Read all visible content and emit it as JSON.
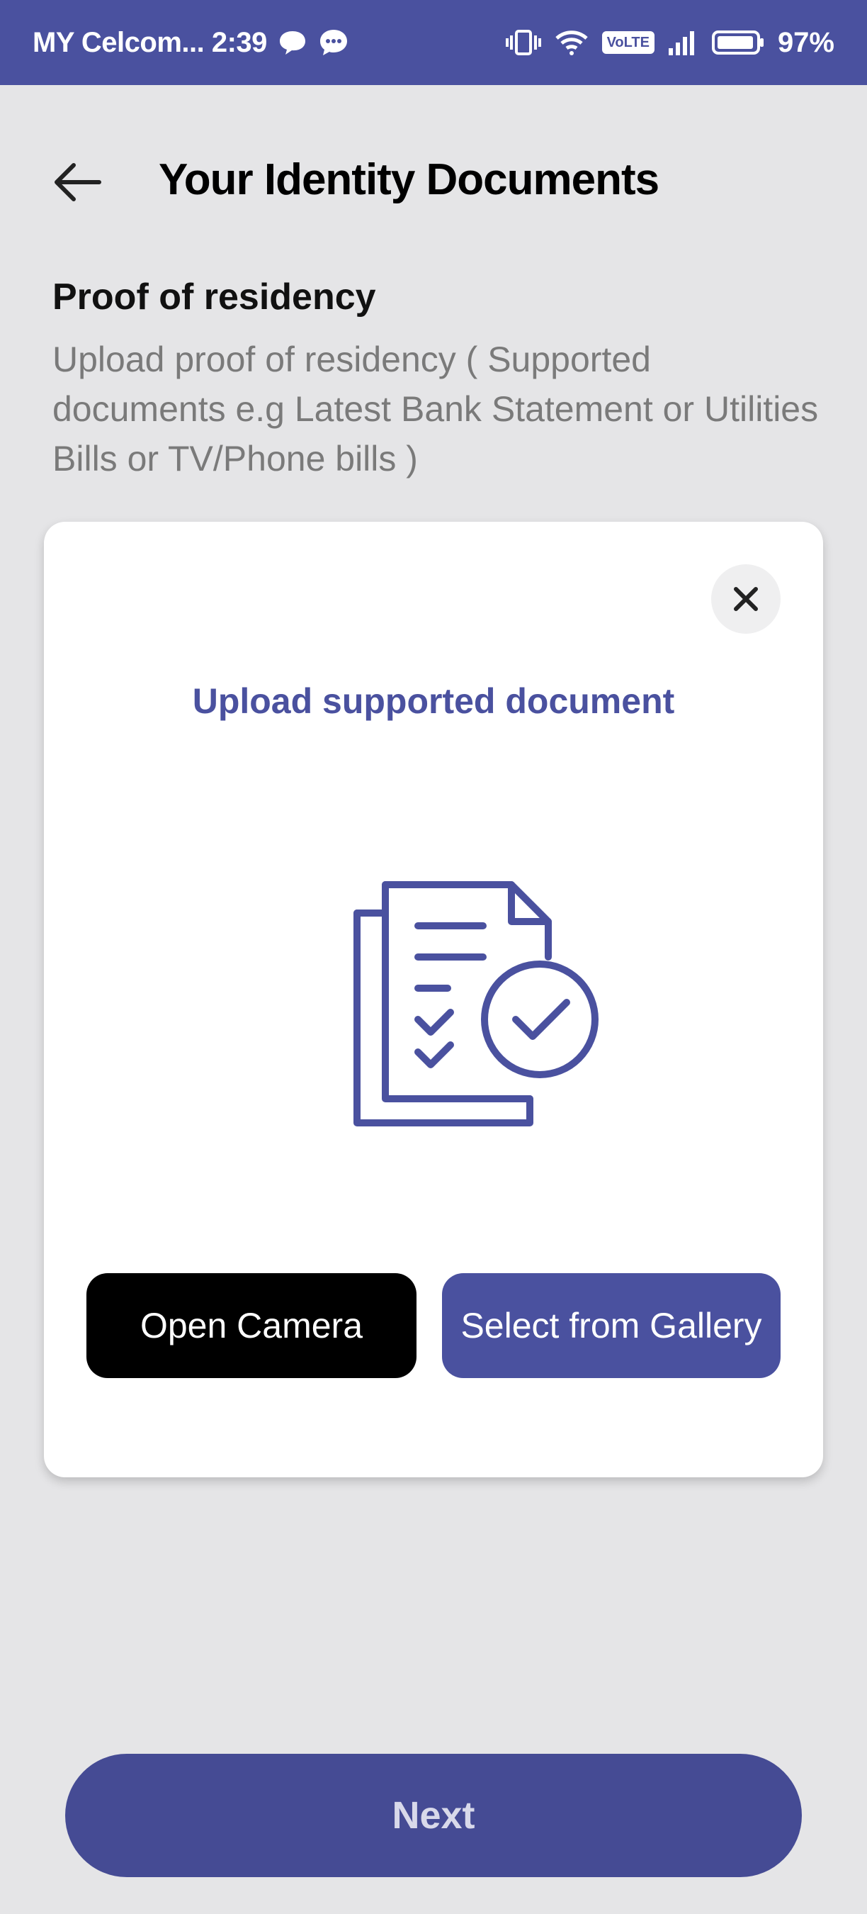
{
  "status_bar": {
    "carrier_time": "MY Celcom... 2:39",
    "volte": "VoLTE",
    "battery": "97%",
    "icons": [
      "chat-bubble-icon",
      "message-dots-icon",
      "vibrate-icon",
      "wifi-icon",
      "volte-icon",
      "signal-icon",
      "battery-icon"
    ]
  },
  "header": {
    "title": "Your Identity Documents",
    "back_icon": "arrow-left-icon"
  },
  "section": {
    "title": "Proof of residency",
    "description": "Upload proof of residency ( Supported documents e.g Latest Bank Statement or Utilities Bills or TV/Phone bills )"
  },
  "upload_card": {
    "heading": "Upload supported document",
    "close_icon": "close-icon",
    "illustration_icon": "document-checklist-icon",
    "open_camera_label": "Open Camera",
    "gallery_label": "Select from Gallery"
  },
  "footer": {
    "next_label": "Next"
  },
  "colors": {
    "brand": "#4a519f",
    "next_button": "#454b94",
    "background": "#e5e5e7",
    "camera_button": "#000000"
  }
}
